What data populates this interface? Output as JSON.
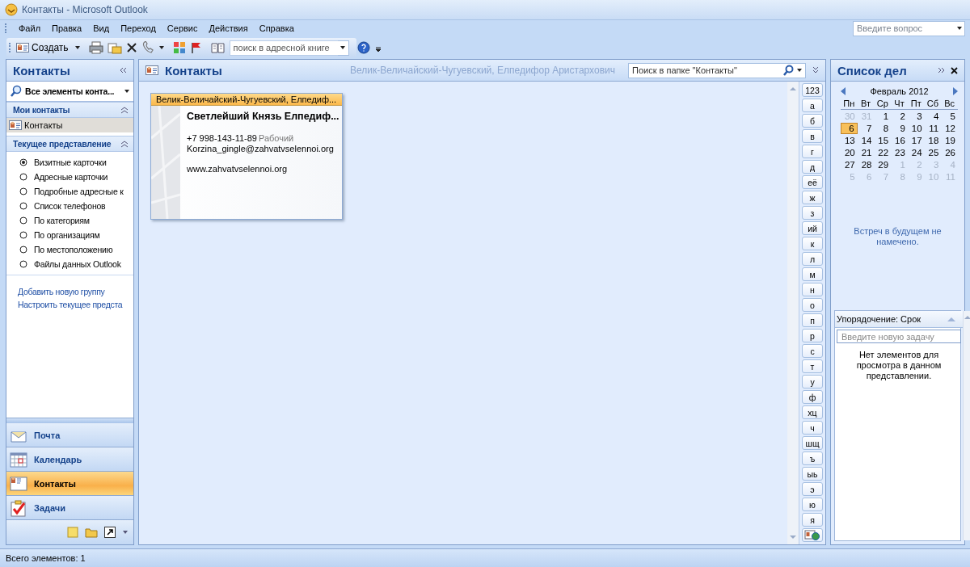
{
  "window": {
    "title": "Контакты - Microsoft Outlook"
  },
  "menu": [
    "Файл",
    "Правка",
    "Вид",
    "Переход",
    "Сервис",
    "Действия",
    "Справка"
  ],
  "help_search": {
    "placeholder": "Введите вопрос"
  },
  "toolbar": {
    "create_label": "Создать",
    "address_search": {
      "placeholder": "поиск в адресной книге"
    }
  },
  "navigation_pane": {
    "title": "Контакты",
    "filter": "Все элементы конта...",
    "my_contacts": {
      "title": "Мои контакты",
      "items": [
        {
          "label": "Контакты",
          "selected": true
        }
      ]
    },
    "current_view": {
      "title": "Текущее представление",
      "options": [
        {
          "label": "Визитные карточки",
          "selected": true
        },
        {
          "label": "Адресные карточки",
          "selected": false
        },
        {
          "label": "Подробные адресные к",
          "selected": false
        },
        {
          "label": "Список телефонов",
          "selected": false
        },
        {
          "label": "По категориям",
          "selected": false
        },
        {
          "label": "По организациям",
          "selected": false
        },
        {
          "label": "По местоположению",
          "selected": false
        },
        {
          "label": "Файлы данных Outlook",
          "selected": false
        }
      ]
    },
    "links": [
      "Добавить новую группу",
      "Настроить текущее предста"
    ],
    "buttons": [
      {
        "kind": "mail",
        "label": "Почта",
        "selected": false
      },
      {
        "kind": "calendar",
        "label": "Календарь",
        "selected": false
      },
      {
        "kind": "contacts",
        "label": "Контакты",
        "selected": true
      },
      {
        "kind": "tasks",
        "label": "Задачи",
        "selected": false
      }
    ]
  },
  "content": {
    "title": "Контакты",
    "selected_name": "Велик-Величайский-Чугуевский, Елпедифор Аристархович",
    "search": {
      "placeholder": "Поиск в папке \"Контакты\""
    },
    "cards": [
      {
        "header": "Велик-Величайский-Чугуевский, Елпедиф...",
        "name": "Светлейший Князь Елпедиф...",
        "phone": "+7 998-143-11-89",
        "phone_label": "Рабочий",
        "email": "Korzina_gingle@zahvatvselennoi.org",
        "website": "www.zahvatvselennoi.org"
      }
    ],
    "alphabet": [
      "123",
      "а",
      "б",
      "в",
      "г",
      "д",
      "её",
      "ж",
      "з",
      "ий",
      "к",
      "л",
      "м",
      "н",
      "о",
      "п",
      "р",
      "с",
      "т",
      "у",
      "ф",
      "хц",
      "ч",
      "шщ",
      "ъ",
      "ыь",
      "э",
      "ю",
      "я"
    ]
  },
  "todo_bar": {
    "title": "Список дел",
    "calendar": {
      "month": "Февраль 2012",
      "weekdays": [
        "Пн",
        "Вт",
        "Ср",
        "Чт",
        "Пт",
        "Сб",
        "Вс"
      ],
      "weeks": [
        [
          {
            "d": "30",
            "other": true,
            "selected": false
          },
          {
            "d": "31",
            "other": true,
            "selected": false
          },
          {
            "d": "1",
            "other": false,
            "selected": false
          },
          {
            "d": "2",
            "other": false,
            "selected": false
          },
          {
            "d": "3",
            "other": false,
            "selected": false
          },
          {
            "d": "4",
            "other": false,
            "selected": false
          },
          {
            "d": "5",
            "other": false,
            "selected": false
          }
        ],
        [
          {
            "d": "6",
            "other": false,
            "selected": true
          },
          {
            "d": "7",
            "other": false,
            "selected": false
          },
          {
            "d": "8",
            "other": false,
            "selected": false
          },
          {
            "d": "9",
            "other": false,
            "selected": false
          },
          {
            "d": "10",
            "other": false,
            "selected": false
          },
          {
            "d": "11",
            "other": false,
            "selected": false
          },
          {
            "d": "12",
            "other": false,
            "selected": false
          }
        ],
        [
          {
            "d": "13",
            "other": false,
            "selected": false
          },
          {
            "d": "14",
            "other": false,
            "selected": false
          },
          {
            "d": "15",
            "other": false,
            "selected": false
          },
          {
            "d": "16",
            "other": false,
            "selected": false
          },
          {
            "d": "17",
            "other": false,
            "selected": false
          },
          {
            "d": "18",
            "other": false,
            "selected": false
          },
          {
            "d": "19",
            "other": false,
            "selected": false
          }
        ],
        [
          {
            "d": "20",
            "other": false,
            "selected": false
          },
          {
            "d": "21",
            "other": false,
            "selected": false
          },
          {
            "d": "22",
            "other": false,
            "selected": false
          },
          {
            "d": "23",
            "other": false,
            "selected": false
          },
          {
            "d": "24",
            "other": false,
            "selected": false
          },
          {
            "d": "25",
            "other": false,
            "selected": false
          },
          {
            "d": "26",
            "other": false,
            "selected": false
          }
        ],
        [
          {
            "d": "27",
            "other": false,
            "selected": false
          },
          {
            "d": "28",
            "other": false,
            "selected": false
          },
          {
            "d": "29",
            "other": false,
            "selected": false
          },
          {
            "d": "1",
            "other": true,
            "selected": false
          },
          {
            "d": "2",
            "other": true,
            "selected": false
          },
          {
            "d": "3",
            "other": true,
            "selected": false
          },
          {
            "d": "4",
            "other": true,
            "selected": false
          }
        ],
        [
          {
            "d": "5",
            "other": true,
            "selected": false
          },
          {
            "d": "6",
            "other": true,
            "selected": false
          },
          {
            "d": "7",
            "other": true,
            "selected": false
          },
          {
            "d": "8",
            "other": true,
            "selected": false
          },
          {
            "d": "9",
            "other": true,
            "selected": false
          },
          {
            "d": "10",
            "other": true,
            "selected": false
          },
          {
            "d": "11",
            "other": true,
            "selected": false
          }
        ]
      ]
    },
    "appointments_message": "Встреч в будущем не намечено.",
    "tasks": {
      "arrange_label": "Упорядочение: Срок",
      "new_task": {
        "placeholder": "Введите новую задачу"
      },
      "empty_message": "Нет элементов для просмотра в данном представлении."
    }
  },
  "status_bar": {
    "text": "Всего элементов: 1"
  }
}
